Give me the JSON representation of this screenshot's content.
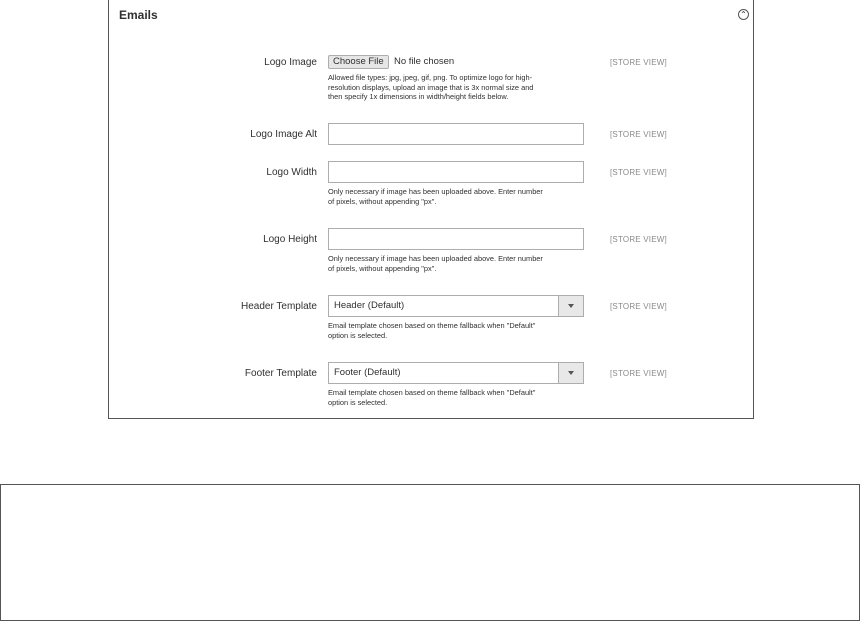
{
  "section": {
    "title": "Emails"
  },
  "scope_label": "[STORE VIEW]",
  "fields": {
    "logo_image": {
      "label": "Logo Image",
      "button": "Choose File",
      "status": "No file chosen",
      "note_lines": [
        "Allowed file types: jpg, jpeg, gif, png. To optimize logo for high-",
        "resolution displays, upload an image that is 3x normal size and",
        "then specify 1x dimensions in width/height fields below."
      ]
    },
    "logo_image_alt": {
      "label": "Logo Image Alt",
      "value": ""
    },
    "logo_width": {
      "label": "Logo Width",
      "value": "",
      "note_lines": [
        "Only necessary if image has been uploaded above. Enter number",
        "of pixels, without appending \"px\"."
      ]
    },
    "logo_height": {
      "label": "Logo Height",
      "value": "",
      "note_lines": [
        "Only necessary if image has been uploaded above. Enter number",
        "of pixels, without appending \"px\"."
      ]
    },
    "header_template": {
      "label": "Header Template",
      "selected": "Header (Default)",
      "note_lines": [
        "Email template chosen based on theme fallback when \"Default\"",
        "option is selected."
      ]
    },
    "footer_template": {
      "label": "Footer Template",
      "selected": "Footer (Default)",
      "note_lines": [
        "Email template chosen based on theme fallback when \"Default\"",
        "option is selected."
      ]
    }
  }
}
